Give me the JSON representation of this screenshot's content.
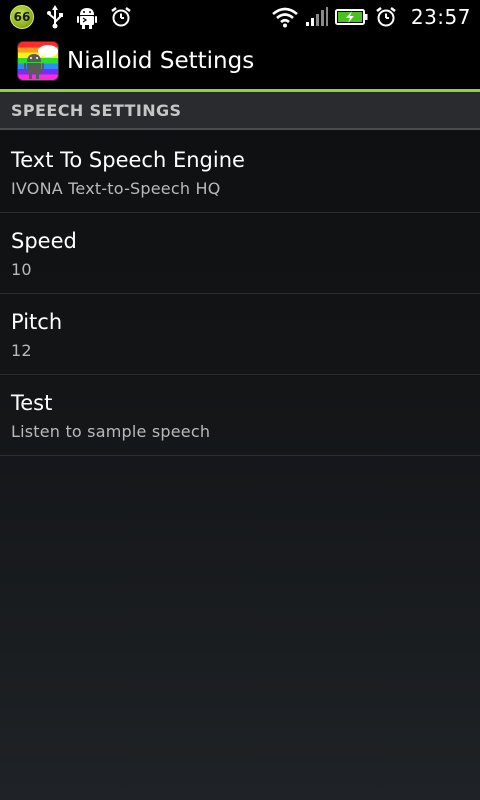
{
  "status_bar": {
    "notification_count": "66",
    "time": "23:57",
    "icons_left": [
      "badge-66",
      "usb-icon",
      "android-debug-icon",
      "alarm-icon"
    ],
    "icons_right": [
      "wifi-icon",
      "signal-icon",
      "battery-charging-icon",
      "alarm-icon"
    ]
  },
  "app": {
    "title": "Nialloid Settings",
    "accent_color": "#8fd43a"
  },
  "category": {
    "label": "SPEECH SETTINGS"
  },
  "preferences": [
    {
      "title": "Text To Speech Engine",
      "summary": "IVONA Text-to-Speech HQ"
    },
    {
      "title": "Speed",
      "summary": "10"
    },
    {
      "title": "Pitch",
      "summary": "12"
    },
    {
      "title": "Test",
      "summary": "Listen to sample speech"
    }
  ]
}
